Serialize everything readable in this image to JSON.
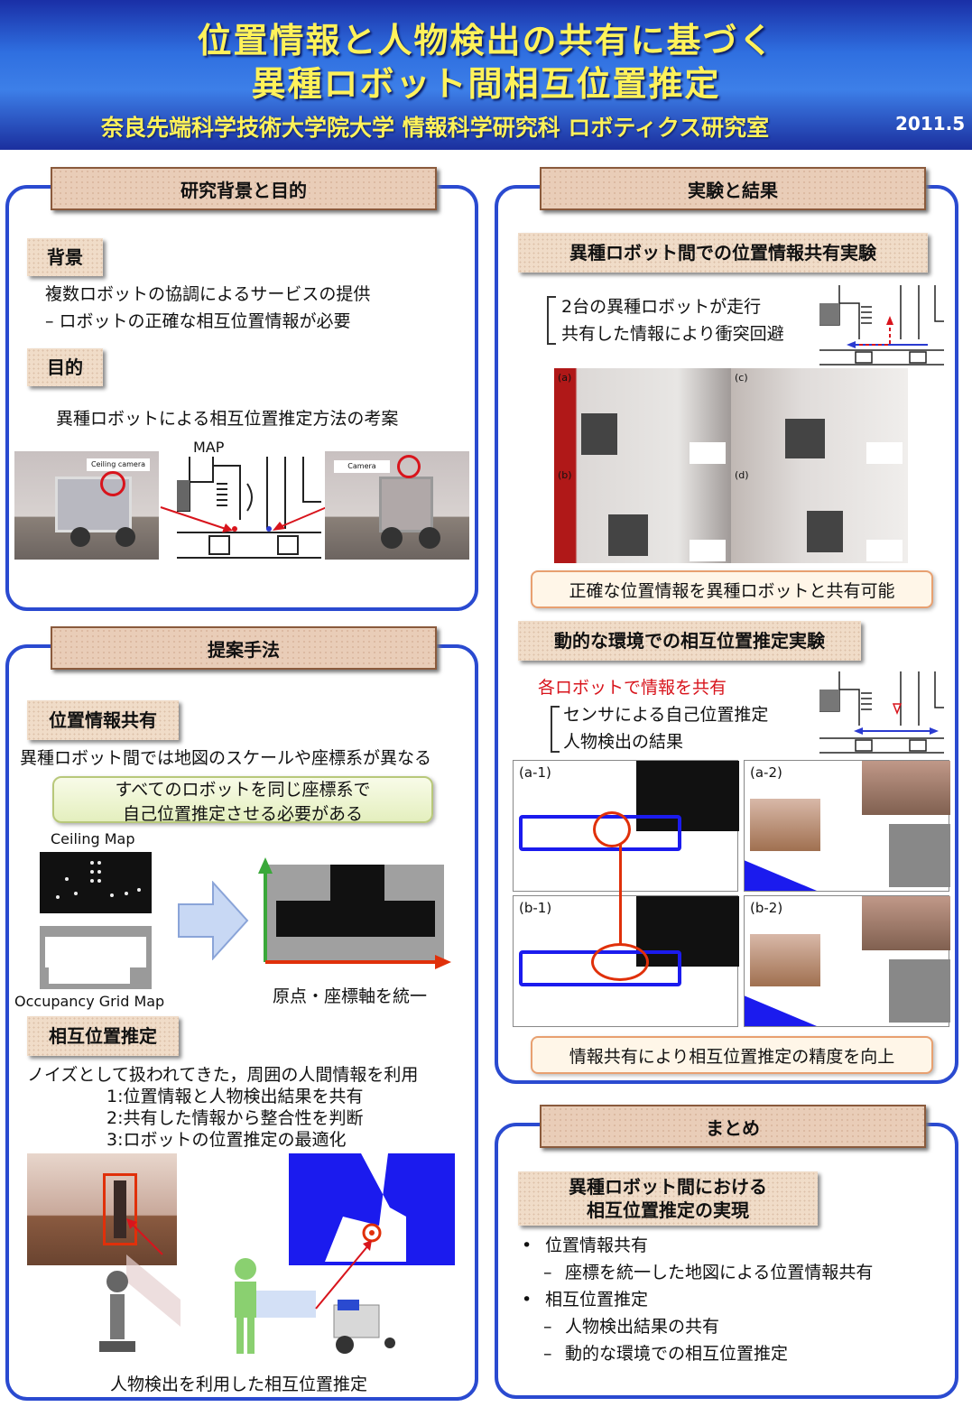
{
  "header": {
    "title_line1": "位置情報と人物検出の共有に基づく",
    "title_line2": "異種ロボット間相互位置推定",
    "affiliation": "奈良先端科学技術大学院大学  情報科学研究科  ロボティクス研究室",
    "date": "2011.5"
  },
  "background": {
    "header": "研究背景と目的",
    "bg_label": "背景",
    "bg_line1": "複数ロボットの協調によるサービスの提供",
    "bg_line2": "– ロボットの正確な相互位置情報が必要",
    "purpose_label": "目的",
    "purpose_text": "異種ロボットによる相互位置推定方法の考案",
    "map_label": "MAP",
    "ceiling_camera_tag": "Ceiling camera",
    "camera_tag": "Camera"
  },
  "method": {
    "header": "提案手法",
    "share_label": "位置情報共有",
    "share_text": "異種ロボット間では地図のスケールや座標系が異なる",
    "note_line1": "すべてのロボットを同じ座標系で",
    "note_line2": "自己位置推定させる必要がある",
    "ceiling_map": "Ceiling Map",
    "occupancy_map": "Occupancy Grid Map",
    "unify_caption": "原点・座標軸を統一",
    "mutual_label": "相互位置推定",
    "mutual_intro": "ノイズとして扱われてきた，周囲の人間情報を利用",
    "step1": "1:位置情報と人物検出結果を共有",
    "step2": "2:共有した情報から整合性を判断",
    "step3": "3:ロボットの位置推定の最適化",
    "figure_caption": "人物検出を利用した相互位置推定"
  },
  "experiment": {
    "header": "実験と結果",
    "exp1_label": "異種ロボット間での位置情報共有実験",
    "exp1_line1": "2台の異種ロボットが走行",
    "exp1_line2": "共有した情報により衝突回避",
    "frame_a": "(a)",
    "frame_b": "(b)",
    "frame_c": "(c)",
    "frame_d": "(d)",
    "exp1_result": "正確な位置情報を異種ロボットと共有可能",
    "exp2_label": "動的な環境での相互位置推定実験",
    "exp2_red": "各ロボットで情報を共有",
    "exp2_line1": "センサによる自己位置推定",
    "exp2_line2": "人物検出の結果",
    "a1": "(a-1)",
    "a2": "(a-2)",
    "b1": "(b-1)",
    "b2": "(b-2)",
    "exp2_result": "情報共有により相互位置推定の精度を向上"
  },
  "summary": {
    "header": "まとめ",
    "sub_line1": "異種ロボット間における",
    "sub_line2": "相互位置推定の実現",
    "item1": "位置情報共有",
    "item1_sub": "座標を統一した地図による位置情報共有",
    "item2": "相互位置推定",
    "item2_sub1": "人物検出結果の共有",
    "item2_sub2": "動的な環境での相互位置推定"
  }
}
